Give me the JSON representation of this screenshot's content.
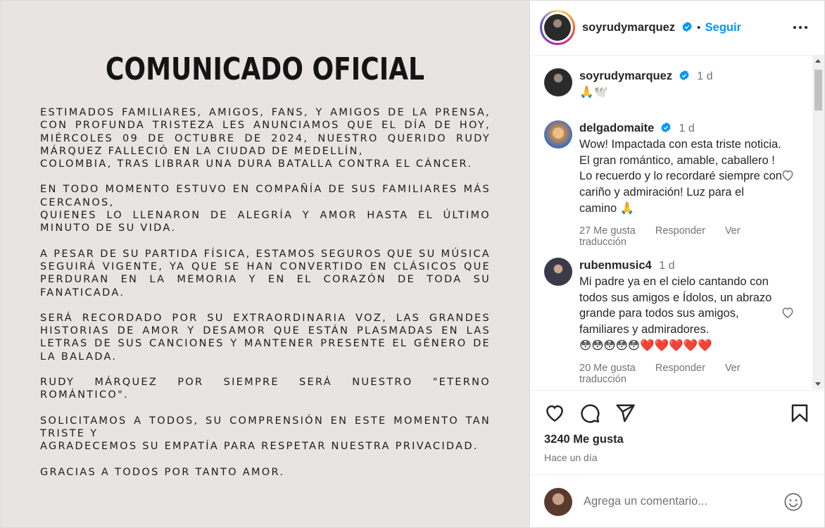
{
  "image": {
    "title": "COMUNICADO OFICIAL",
    "paragraphs": [
      "Estimados familiares, amigos, fans, y amigos de la prensa, con profunda tristeza les anunciamos que el día de hoy, miércoles 09 de octubre de 2024, nuestro querido Rudy Márquez falleció en la ciudad de Medellín,\nColombia, tras librar una dura batalla contra el cáncer.",
      "En todo momento estuvo en compañía de sus familiares más cercanos,\nquienes lo llenaron de alegría y amor hasta el último minuto de su vida.",
      "A pesar de su partida física, estamos seguros que su música seguirá vigente, ya que se han convertido en clásicos que perduran en la memoria y en el corazón de toda su fanaticada.",
      "Será recordado por su extraordinaria voz, las grandes historias de amor y desamor que están plasmadas en las letras de sus canciones y mantener presente el género de la balada.",
      "Rudy Márquez por siempre será nuestro \"Eterno Romántico\".",
      "Solicitamos a todos, su comprensión en este momento tan triste y\nagradecemos su empatía para respetar nuestra privacidad.",
      "Gracias a todos por tanto amor."
    ]
  },
  "header": {
    "username": "soyrudymarquez",
    "separator": "•",
    "follow_label": "Seguir"
  },
  "caption": {
    "username": "soyrudymarquez",
    "time": "1 d",
    "text": "🙏🕊️"
  },
  "comments": [
    {
      "username": "delgadomaite",
      "time": "1 d",
      "text": "Wow! Impactada con esta triste noticia. El gran romántico, amable, caballero ! Lo recuerdo y lo recordaré siempre con cariño y admiración! Luz para el camino 🙏",
      "likes": "27 Me gusta",
      "reply": "Responder",
      "translate": "Ver traducción"
    },
    {
      "username": "rubenmusic4",
      "time": "1 d",
      "text": "Mi padre ya en el cielo cantando con todos sus amigos e Ídolos, un abrazo grande para todos sus amigos, familiares y admiradores.",
      "emojis": "😳😳😳😳😳❤️❤️❤️❤️❤️",
      "likes": "20 Me gusta",
      "reply": "Responder",
      "translate": "Ver traducción"
    }
  ],
  "likes_count": "3240 Me gusta",
  "posted_ago": "Hace un día",
  "comment_placeholder": "Agrega un comentario...",
  "colors": {
    "accent": "#0095f6",
    "verified": "#0095f6",
    "muted": "#737373"
  }
}
